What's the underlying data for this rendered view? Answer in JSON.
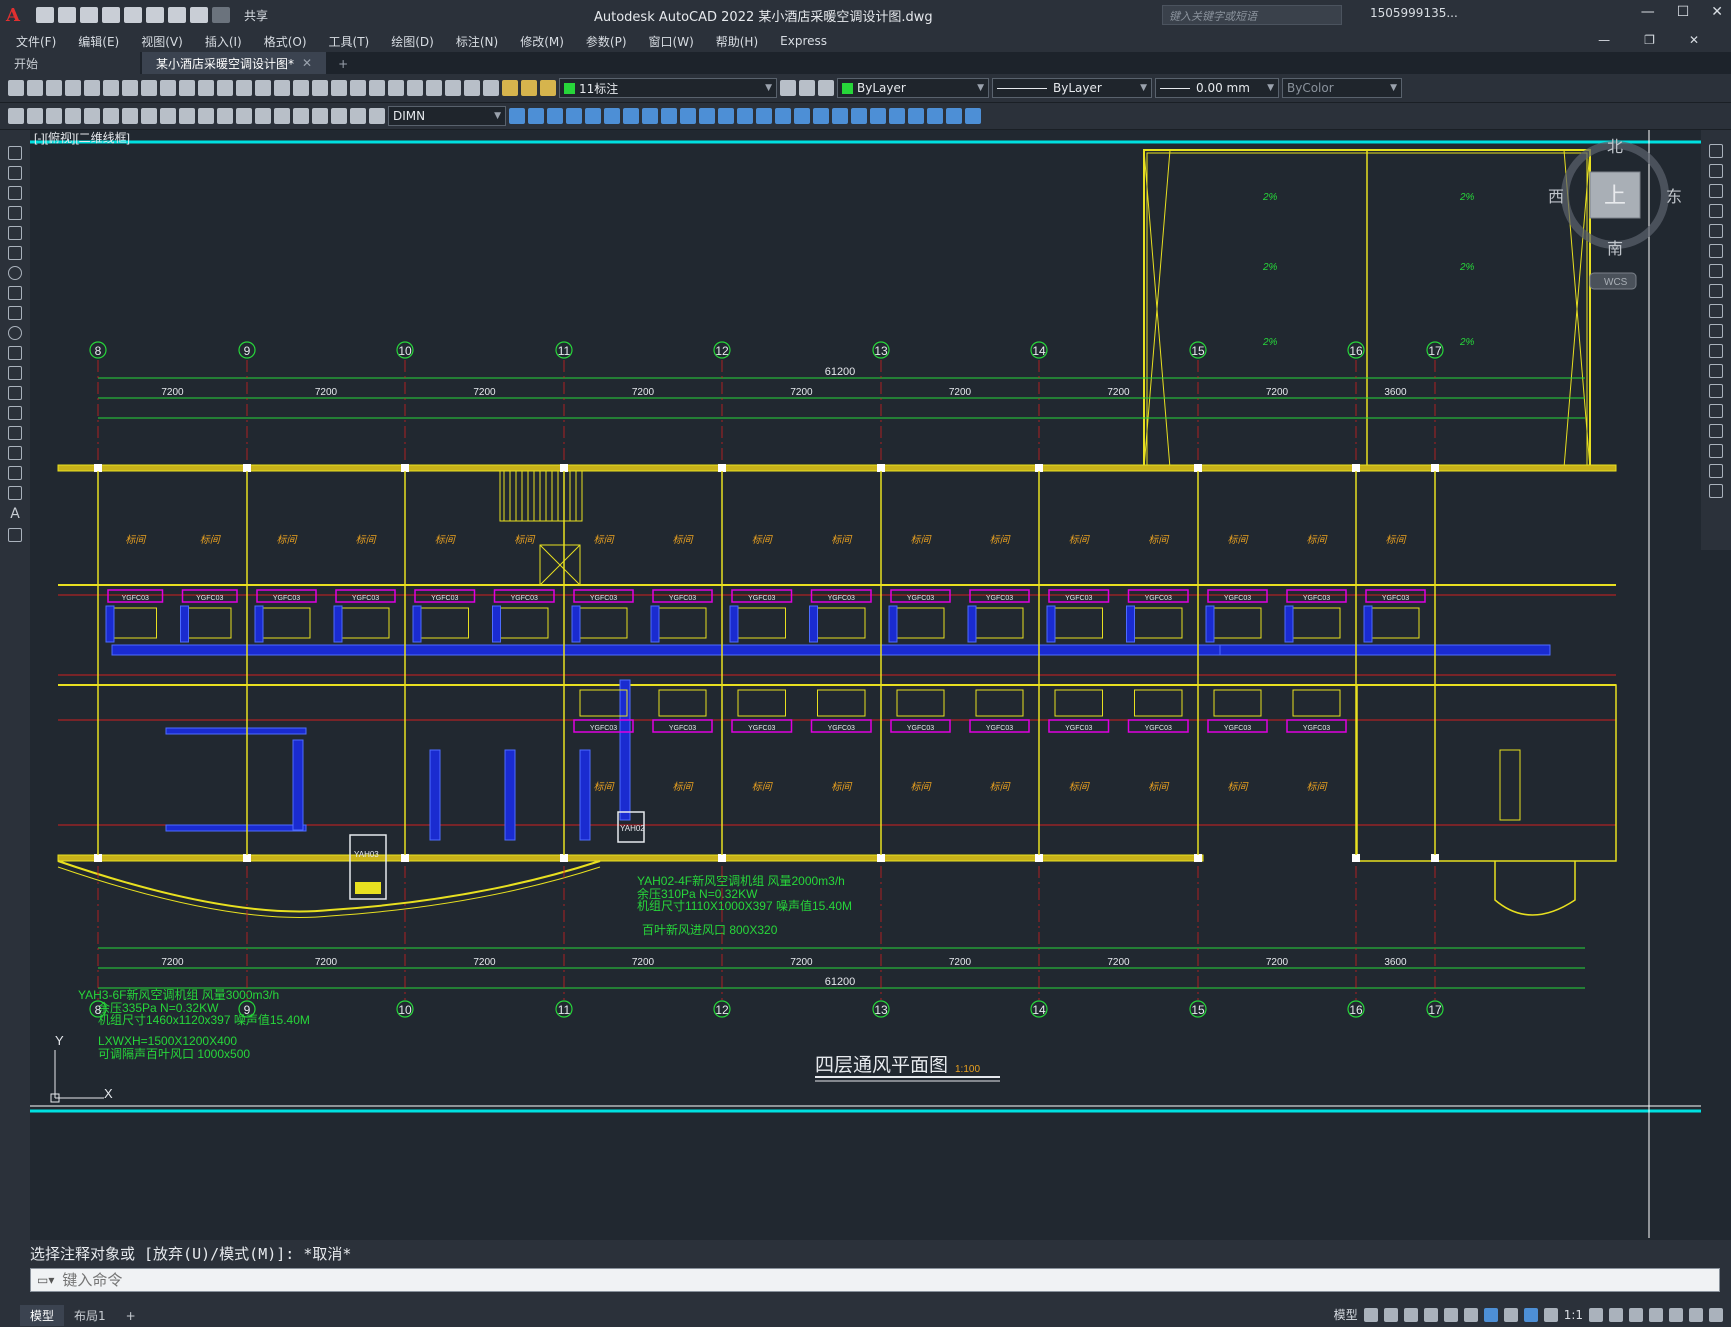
{
  "app": {
    "title": "Autodesk AutoCAD 2022    某小酒店采暖空调设计图.dwg",
    "share_label": "共享",
    "search_placeholder": "键入关键字或短语",
    "user": "1505999135...",
    "logo": "A"
  },
  "menu": [
    "文件(F)",
    "编辑(E)",
    "视图(V)",
    "插入(I)",
    "格式(O)",
    "工具(T)",
    "绘图(D)",
    "标注(N)",
    "修改(M)",
    "参数(P)",
    "窗口(W)",
    "帮助(H)",
    "Express"
  ],
  "tabs": {
    "start": "开始",
    "active": "某小酒店采暖空调设计图*",
    "close": "✕",
    "add": "+"
  },
  "toolbar": {
    "layer": "11标注",
    "color": "ByLayer",
    "linetype": "ByLayer",
    "lineweight": "0.00 mm",
    "plotstyle": "ByColor",
    "dimstyle": "DIMN"
  },
  "viewport_label": "[-][俯视][二维线框]",
  "viewcube": {
    "north": "北",
    "south": "南",
    "east": "东",
    "west": "西",
    "top": "上",
    "wcs": "WCS"
  },
  "drawing": {
    "title": "四层通风平面图",
    "scale": "1:100",
    "total_dim": "61200",
    "axes": [
      "8",
      "9",
      "10",
      "11",
      "12",
      "13",
      "14",
      "15",
      "16",
      "17"
    ],
    "bay_dims": [
      "7200",
      "7200",
      "7200",
      "7200",
      "7200",
      "7200",
      "7200",
      "7200",
      "3600"
    ],
    "room_label": "标间",
    "unit_label": "YGFC03",
    "notes": [
      "YAH02-4F新风空调机组 风量2000m3/h",
      "余压310Pa N=0.32KW",
      "机组尺寸1110X1000X397 噪声值15.40M",
      "百叶新风进风口 800X320",
      "YAH3-6F新风空调机组 风量3000m3/h",
      "余压335Pa N=0.32KW",
      "机组尺寸1460x1120x397 噪声值15.40M",
      "LXWXH=1500X1200X400",
      "可调隔声百叶风口 1000x500"
    ],
    "slope": "2%"
  },
  "command": {
    "history": "选择注释对象或 [放弃(U)/模式(M)]: *取消*",
    "placeholder": "键入命令"
  },
  "status": {
    "model_tab": "模型",
    "layout_tab": "布局1",
    "add": "+",
    "model": "模型",
    "scale": "1:1"
  }
}
